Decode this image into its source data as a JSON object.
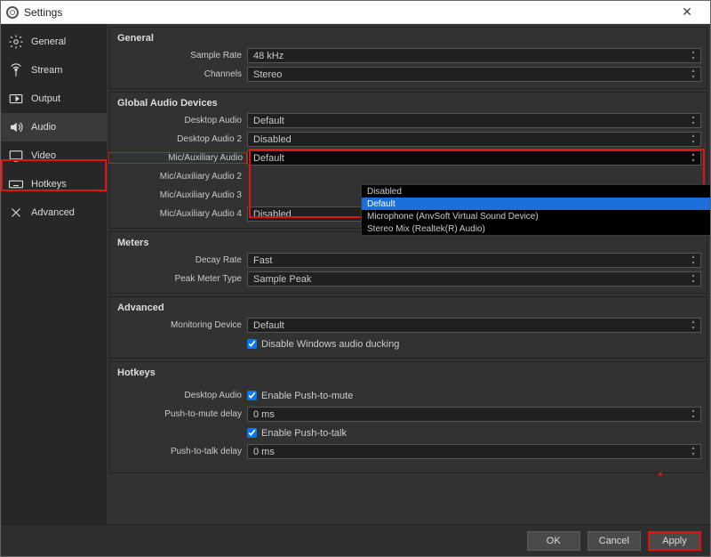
{
  "window": {
    "title": "Settings"
  },
  "sidebar": {
    "items": [
      {
        "label": "General"
      },
      {
        "label": "Stream"
      },
      {
        "label": "Output"
      },
      {
        "label": "Audio"
      },
      {
        "label": "Video"
      },
      {
        "label": "Hotkeys"
      },
      {
        "label": "Advanced"
      }
    ]
  },
  "general": {
    "title": "General",
    "sample_rate_label": "Sample Rate",
    "sample_rate_value": "48 kHz",
    "channels_label": "Channels",
    "channels_value": "Stereo"
  },
  "devices": {
    "title": "Global Audio Devices",
    "desktop_audio_label": "Desktop Audio",
    "desktop_audio_value": "Default",
    "desktop_audio2_label": "Desktop Audio 2",
    "desktop_audio2_value": "Disabled",
    "mic1_label": "Mic/Auxiliary Audio",
    "mic1_value": "Default",
    "mic2_label": "Mic/Auxiliary Audio 2",
    "mic3_label": "Mic/Auxiliary Audio 3",
    "mic4_label": "Mic/Auxiliary Audio 4",
    "mic4_value": "Disabled",
    "dropdown": {
      "options": [
        "Disabled",
        "Default",
        "Microphone (AnvSoft Virtual Sound Device)",
        "Stereo Mix (Realtek(R) Audio)"
      ],
      "selected_index": 1
    }
  },
  "meters": {
    "title": "Meters",
    "decay_label": "Decay Rate",
    "decay_value": "Fast",
    "peak_label": "Peak Meter Type",
    "peak_value": "Sample Peak"
  },
  "advanced": {
    "title": "Advanced",
    "mon_label": "Monitoring Device",
    "mon_value": "Default",
    "ducking_label": "Disable Windows audio ducking"
  },
  "hotkeys": {
    "title": "Hotkeys",
    "da_label": "Desktop Audio",
    "ptm_label": "Enable Push-to-mute",
    "ptm_delay_label": "Push-to-mute delay",
    "ptm_delay_value": "0 ms",
    "ptt_label": "Enable Push-to-talk",
    "ptt_delay_label": "Push-to-talk delay",
    "ptt_delay_value": "0 ms"
  },
  "footer": {
    "ok": "OK",
    "cancel": "Cancel",
    "apply": "Apply"
  }
}
